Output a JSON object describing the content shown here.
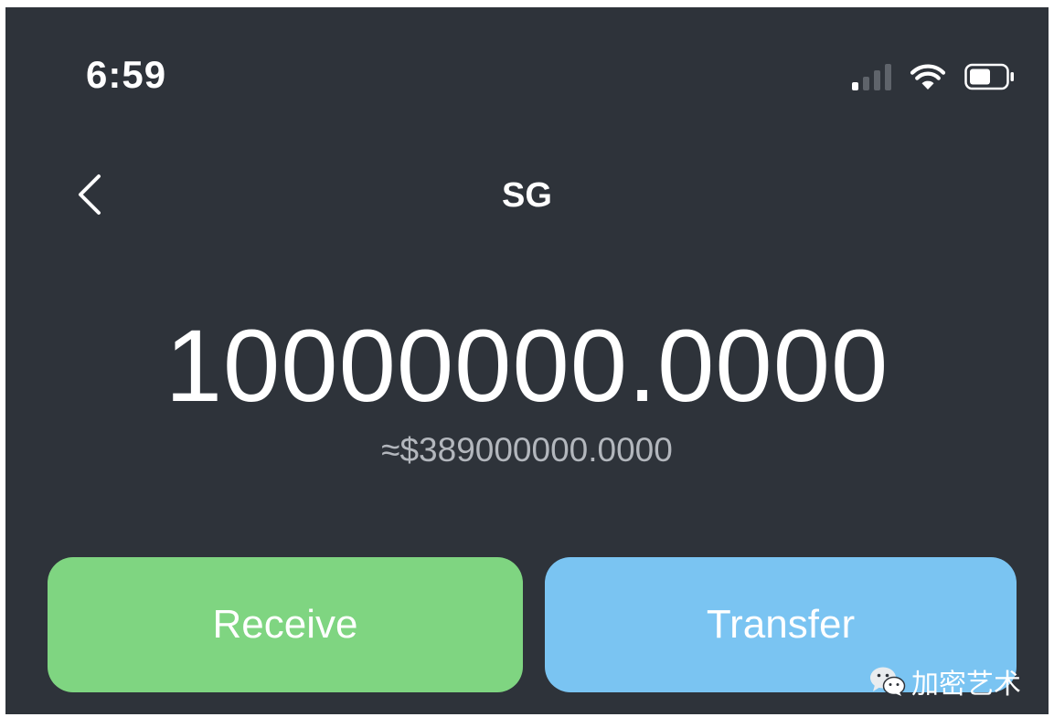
{
  "status_bar": {
    "time": "6:59"
  },
  "nav": {
    "title": "SG"
  },
  "wallet": {
    "balance": "10000000.0000",
    "fiat_value": "≈$389000000.0000"
  },
  "actions": {
    "receive_label": "Receive",
    "transfer_label": "Transfer"
  },
  "watermark": {
    "text": "加密艺术",
    "icon": "wechat-icon"
  },
  "colors": {
    "background": "#2e333a",
    "receive": "#7fd581",
    "transfer": "#7ac4f2",
    "fiat_text": "#b3b7bd"
  }
}
